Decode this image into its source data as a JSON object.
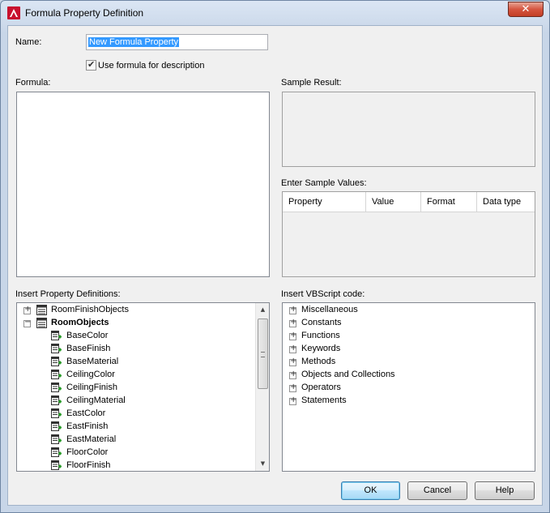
{
  "window": {
    "title": "Formula Property Definition",
    "close_glyph": "✕"
  },
  "name_field": {
    "label": "Name:",
    "value": "New Formula Property"
  },
  "use_formula": {
    "label": "Use formula for description",
    "checked": true
  },
  "formula": {
    "label": "Formula:"
  },
  "sample_result": {
    "label": "Sample Result:"
  },
  "sample_values": {
    "label": "Enter Sample Values:",
    "columns": [
      "Property",
      "Value",
      "Format",
      "Data type"
    ]
  },
  "property_definitions": {
    "label": "Insert Property Definitions:",
    "groups": [
      {
        "label": "RoomFinishObjects",
        "expanded": false
      },
      {
        "label": "RoomObjects",
        "expanded": true
      }
    ],
    "items": [
      "BaseColor",
      "BaseFinish",
      "BaseMaterial",
      "CeilingColor",
      "CeilingFinish",
      "CeilingMaterial",
      "EastColor",
      "EastFinish",
      "EastMaterial",
      "FloorColor",
      "FloorFinish"
    ]
  },
  "vbscript": {
    "label": "Insert VBScript code:",
    "items": [
      "Miscellaneous",
      "Constants",
      "Functions",
      "Keywords",
      "Methods",
      "Objects and Collections",
      "Operators",
      "Statements"
    ]
  },
  "buttons": {
    "ok": "OK",
    "cancel": "Cancel",
    "help": "Help"
  },
  "colors": {
    "selection": "#3399ff",
    "app_icon": "#c8102e",
    "add_icon": "#2b9a2b"
  }
}
